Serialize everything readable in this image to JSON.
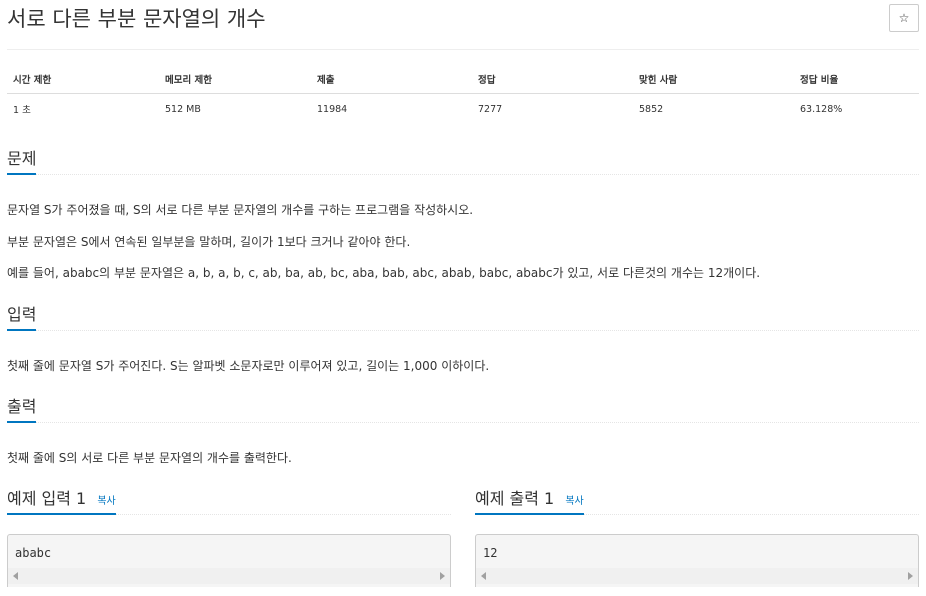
{
  "title": "서로 다른 부분 문자열의 개수",
  "star_label": "☆",
  "info": {
    "headers": [
      "시간 제한",
      "메모리 제한",
      "제출",
      "정답",
      "맞힌 사람",
      "정답 비율"
    ],
    "values": [
      "1 초",
      "512 MB",
      "11984",
      "7277",
      "5852",
      "63.128%"
    ]
  },
  "problem": {
    "heading": "문제",
    "paragraphs": [
      "문자열 S가 주어졌을 때, S의 서로 다른 부분 문자열의 개수를 구하는 프로그램을 작성하시오.",
      "부분 문자열은 S에서 연속된 일부분을 말하며, 길이가 1보다 크거나 같아야 한다.",
      "예를 들어, ababc의 부분 문자열은 a, b, a, b, c, ab, ba, ab, bc, aba, bab, abc, abab, babc, ababc가 있고, 서로 다른것의 개수는 12개이다."
    ]
  },
  "input": {
    "heading": "입력",
    "text": "첫째 줄에 문자열 S가 주어진다. S는 알파벳 소문자로만 이루어져 있고, 길이는 1,000 이하이다."
  },
  "output": {
    "heading": "출력",
    "text": "첫째 줄에 S의 서로 다른 부분 문자열의 개수를 출력한다."
  },
  "sample_input": {
    "heading": "예제 입력 1",
    "copy_label": "복사",
    "content": "ababc"
  },
  "sample_output": {
    "heading": "예제 출력 1",
    "copy_label": "복사",
    "content": "12"
  }
}
